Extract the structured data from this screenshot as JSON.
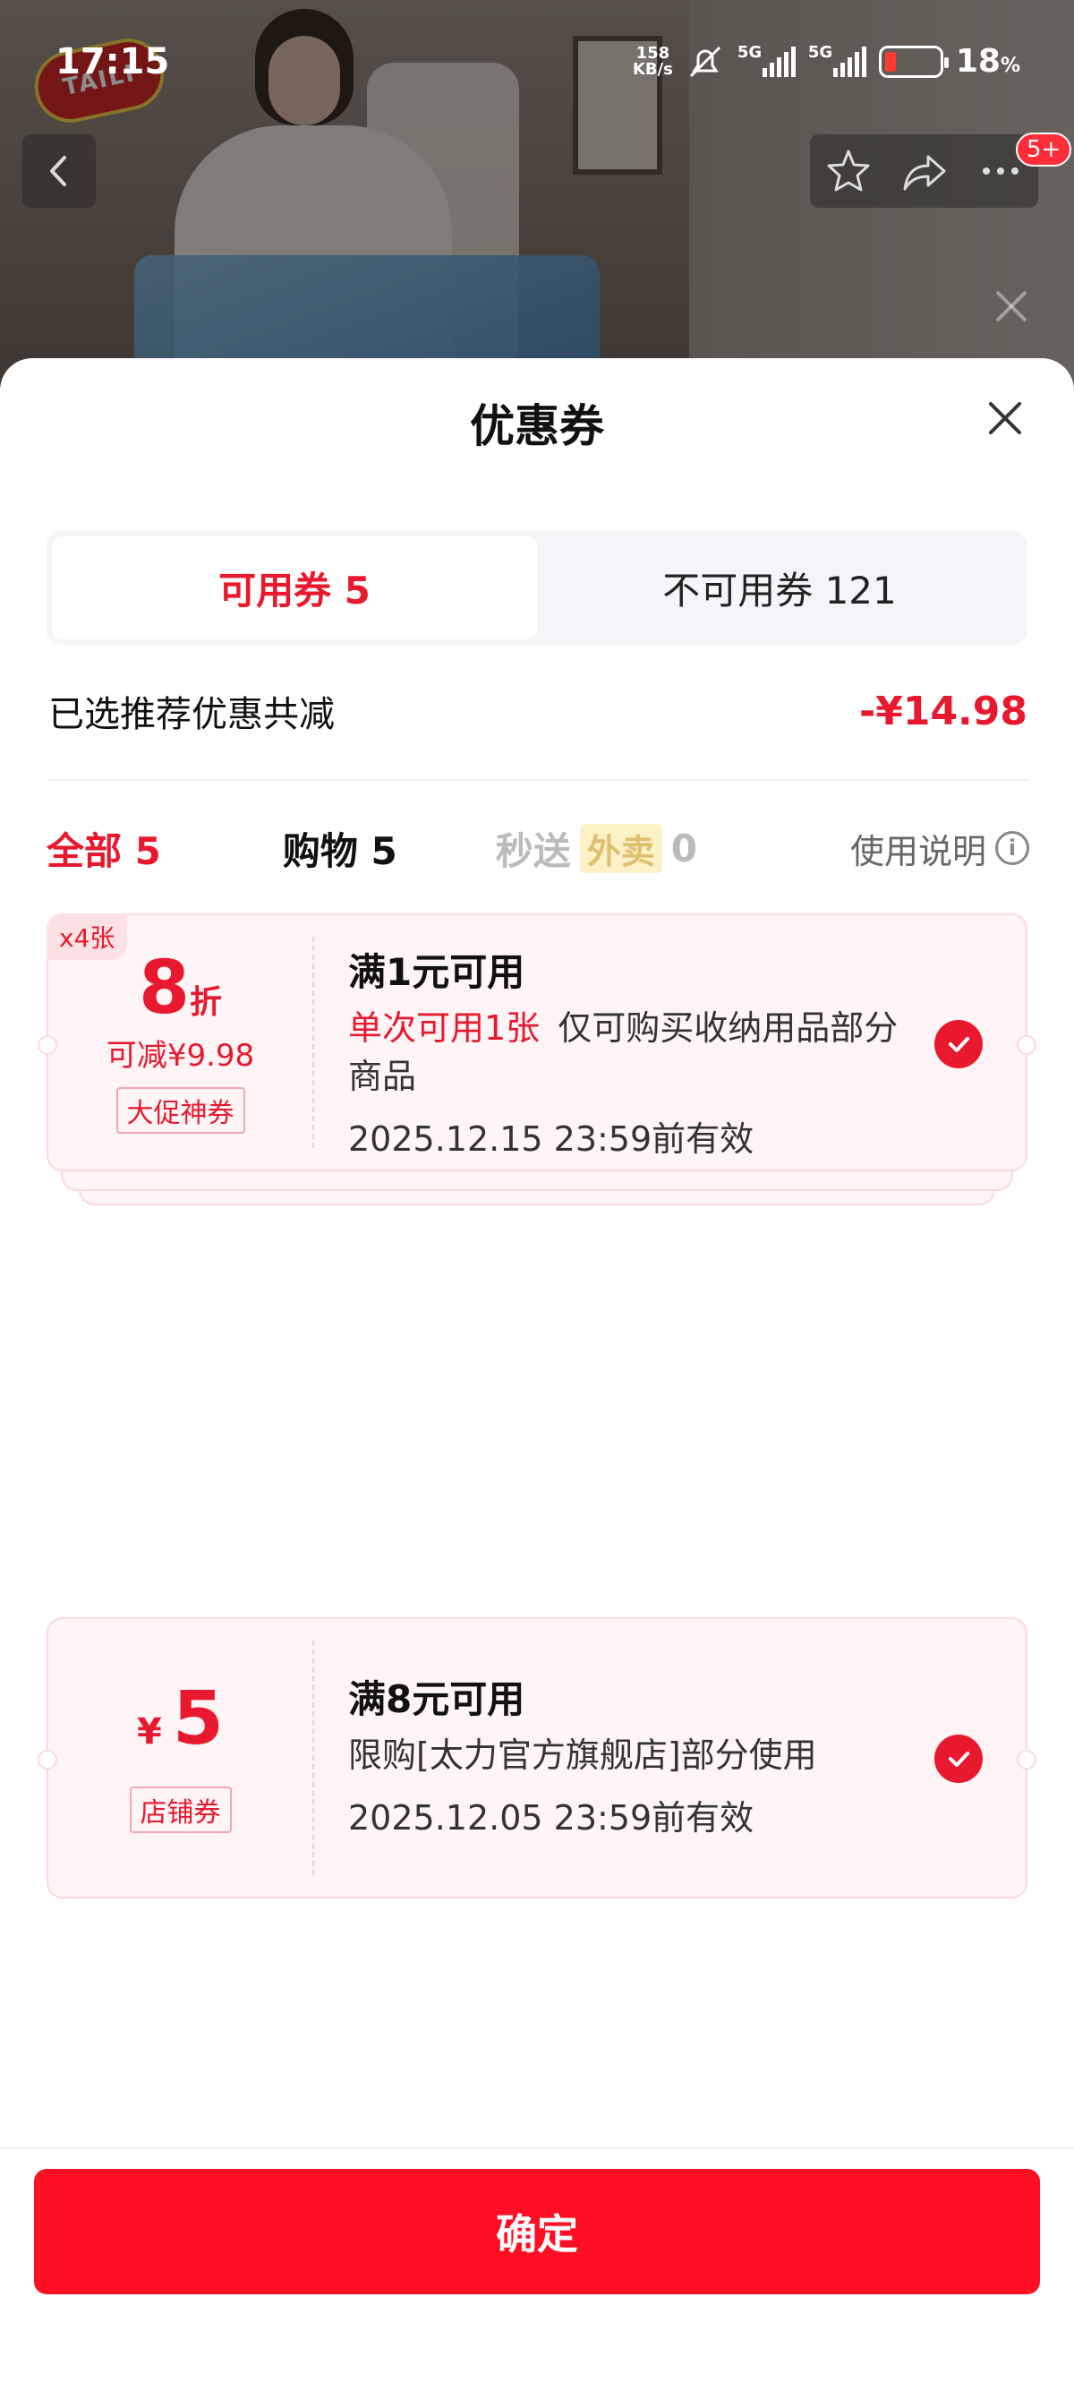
{
  "status_bar": {
    "time": "17:15",
    "net_speed_value": "158",
    "net_speed_unit": "KB/s",
    "signal1_label": "5G",
    "signal2_label": "5G",
    "battery_value": "18",
    "battery_unit": "%"
  },
  "product": {
    "logo_text": "TAILI",
    "cart_badge": "5+"
  },
  "sheet": {
    "title": "优惠券",
    "tabs": [
      {
        "label": "可用券 5",
        "active": true
      },
      {
        "label": "不可用券 121",
        "active": false
      }
    ],
    "summary_label": "已选推荐优惠共减",
    "summary_value": "-¥14.98",
    "filters": {
      "all": "全部 5",
      "shopping": "购物 5",
      "instant": "秒送",
      "takeout_pill": "外卖",
      "instant_count": "0",
      "usage_guide": "使用说明"
    }
  },
  "coupons": [
    {
      "quantity_tag": "x4张",
      "value_number": "8",
      "value_unit": "折",
      "subtext": "可减¥9.98",
      "tag": "大促神券",
      "title": "满1元可用",
      "highlight": "单次可用1张",
      "description": "仅可购买收纳用品部分商品",
      "validity": "2025.12.15 23:59前有效",
      "selected": true
    },
    {
      "currency": "¥",
      "value_number": "5",
      "tag": "店铺券",
      "title": "满8元可用",
      "description": "限购[太力官方旗舰店]部分使用",
      "validity": "2025.12.05 23:59前有效",
      "selected": true
    }
  ],
  "footer": {
    "confirm_label": "确定"
  },
  "colors": {
    "accent": "#e8192e",
    "confirm_button": "#ff0f24",
    "coupon_bg": "#fff5f6"
  }
}
